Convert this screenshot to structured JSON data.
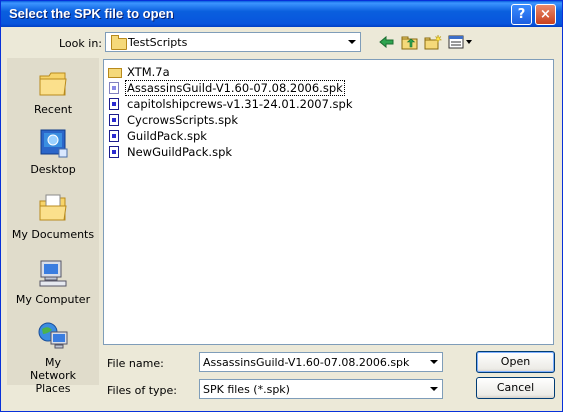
{
  "window": {
    "title": "Select the SPK file to open"
  },
  "titlebar": {
    "help_label": "?",
    "close_label": "×"
  },
  "lookin": {
    "label": "Look in:",
    "value": "TestScripts"
  },
  "toolbar": {
    "icons": [
      "back-icon",
      "up-folder-icon",
      "new-folder-icon",
      "view-menu-icon"
    ]
  },
  "places": [
    {
      "label": "Recent",
      "icon": "recent-icon"
    },
    {
      "label": "Desktop",
      "icon": "desktop-icon"
    },
    {
      "label": "My Documents",
      "icon": "my-documents-icon"
    },
    {
      "label": "My Computer",
      "icon": "my-computer-icon"
    },
    {
      "label": "My Network Places",
      "icon": "network-places-icon"
    }
  ],
  "files": [
    {
      "name": "XTM.7a",
      "type": "folder"
    },
    {
      "name": "AssassinsGuild-V1.60-07.08.2006.spk",
      "type": "spk",
      "selected": true
    },
    {
      "name": "capitolshipcrews-v1.31-24.01.2007.spk",
      "type": "spk"
    },
    {
      "name": "CycrowsScripts.spk",
      "type": "spk"
    },
    {
      "name": "GuildPack.spk",
      "type": "spk"
    },
    {
      "name": "NewGuildPack.spk",
      "type": "spk"
    }
  ],
  "filename": {
    "label": "File name:",
    "value": "AssassinsGuild-V1.60-07.08.2006.spk"
  },
  "filetype": {
    "label": "Files of type:",
    "value": "SPK files (*.spk)"
  },
  "buttons": {
    "open": "Open",
    "cancel": "Cancel"
  }
}
